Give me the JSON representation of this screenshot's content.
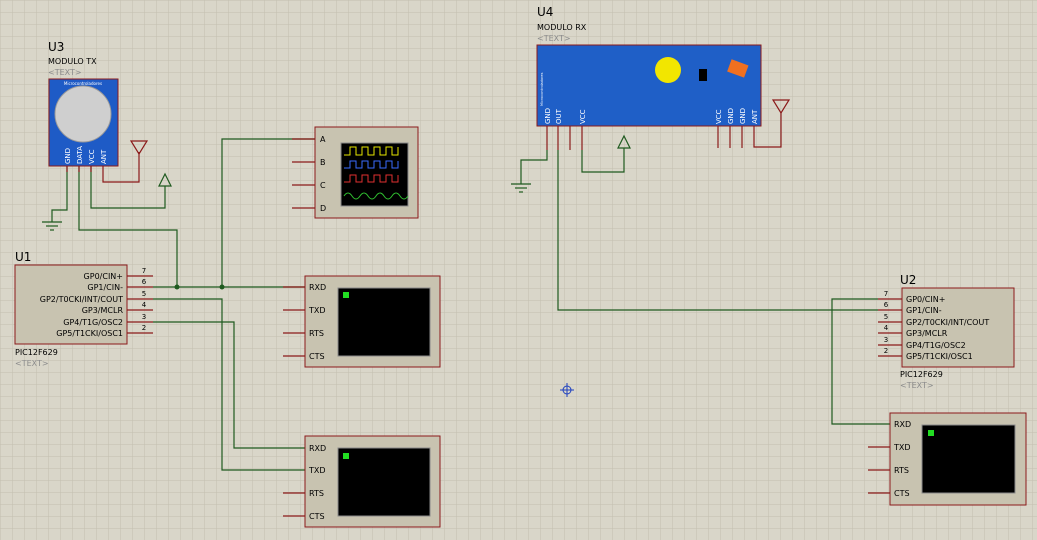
{
  "u3": {
    "ref": "U3",
    "name": "MODULO TX",
    "text": "<TEXT>",
    "board_label": "Microcontroladores",
    "pins": [
      "GND",
      "DATA",
      "VCC",
      "ANT"
    ]
  },
  "u4": {
    "ref": "U4",
    "name": "MODULO RX",
    "text": "<TEXT>",
    "side_label": "Microcontroladores",
    "pins": [
      "GND",
      "OUT",
      "VCC",
      "VCC",
      "GND",
      "GND",
      "ANT"
    ]
  },
  "u1": {
    "ref": "U1",
    "part": "PIC12F629",
    "text": "<TEXT>",
    "pins": [
      {
        "num": "7",
        "label": "GP0/CIN+"
      },
      {
        "num": "6",
        "label": "GP1/CIN-"
      },
      {
        "num": "5",
        "label": "GP2/T0CKI/INT/COUT"
      },
      {
        "num": "4",
        "label": "GP3/MCLR"
      },
      {
        "num": "3",
        "label": "GP4/T1G/OSC2"
      },
      {
        "num": "2",
        "label": "GP5/T1CKI/OSC1"
      }
    ]
  },
  "u2": {
    "ref": "U2",
    "part": "PIC12F629",
    "text": "<TEXT>",
    "pins": [
      {
        "num": "7",
        "label": "GP0/CIN+"
      },
      {
        "num": "6",
        "label": "GP1/CIN-"
      },
      {
        "num": "5",
        "label": "GP2/T0CKI/INT/COUT"
      },
      {
        "num": "4",
        "label": "GP3/MCLR"
      },
      {
        "num": "3",
        "label": "GP4/T1G/OSC2"
      },
      {
        "num": "2",
        "label": "GP5/T1CKI/OSC1"
      }
    ]
  },
  "scope": {
    "channels": [
      "A",
      "B",
      "C",
      "D"
    ]
  },
  "terminal1": {
    "pins": [
      "RXD",
      "TXD",
      "RTS",
      "CTS"
    ]
  },
  "terminal2": {
    "pins": [
      "RXD",
      "TXD",
      "RTS",
      "CTS"
    ]
  },
  "terminal3": {
    "pins": [
      "RXD",
      "TXD",
      "RTS",
      "CTS"
    ]
  },
  "colors": {
    "grid": "#c6c3b4",
    "background": "#d9d6c9",
    "wire": "#1f5a1f",
    "component": "#8b1a1a",
    "body": "#c8c3b0",
    "module_blue": "#1f5fc7"
  }
}
